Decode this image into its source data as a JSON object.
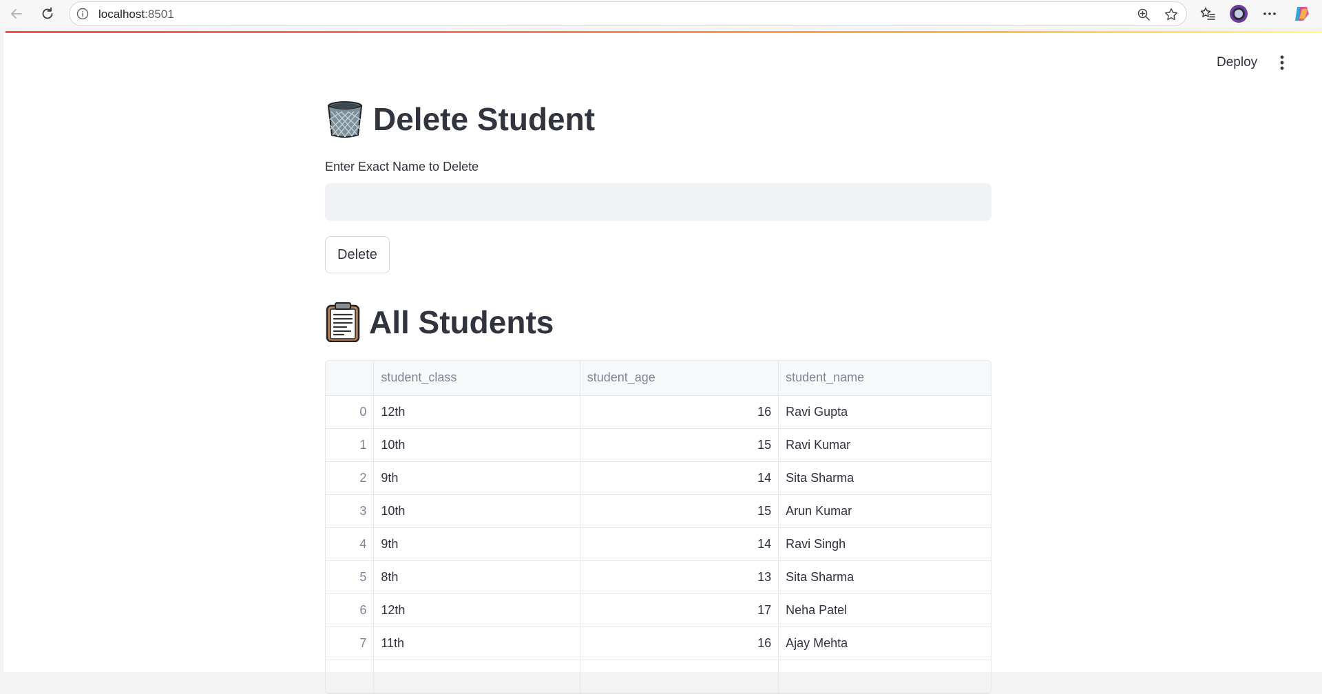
{
  "browser": {
    "url_host": "localhost",
    "url_port": ":8501",
    "icons": [
      "back-arrow-icon",
      "reload-icon",
      "site-info-icon",
      "zoom-icon",
      "star-icon",
      "favorites-icon",
      "profile-icon",
      "more-icon",
      "copilot-icon"
    ]
  },
  "header": {
    "deploy_label": "Deploy",
    "menu_icon": "kebab-menu-icon"
  },
  "delete_section": {
    "title": "Delete Student",
    "title_icon": "wastebasket-icon",
    "input_label": "Enter Exact Name to Delete",
    "input_value": "",
    "button_label": "Delete"
  },
  "students_section": {
    "title": "All Students",
    "title_icon": "clipboard-icon",
    "columns": [
      "student_class",
      "student_age",
      "student_name"
    ],
    "rows": [
      {
        "index": "0",
        "student_class": "12th",
        "student_age": "16",
        "student_name": "Ravi Gupta"
      },
      {
        "index": "1",
        "student_class": "10th",
        "student_age": "15",
        "student_name": "Ravi Kumar"
      },
      {
        "index": "2",
        "student_class": "9th",
        "student_age": "14",
        "student_name": "Sita Sharma"
      },
      {
        "index": "3",
        "student_class": "10th",
        "student_age": "15",
        "student_name": "Arun Kumar"
      },
      {
        "index": "4",
        "student_class": "9th",
        "student_age": "14",
        "student_name": "Ravi Singh"
      },
      {
        "index": "5",
        "student_class": "8th",
        "student_age": "13",
        "student_name": "Sita Sharma"
      },
      {
        "index": "6",
        "student_class": "12th",
        "student_age": "17",
        "student_name": "Neha Patel"
      },
      {
        "index": "7",
        "student_class": "11th",
        "student_age": "16",
        "student_name": "Ajay Mehta"
      }
    ]
  },
  "colors": {
    "accent": "#ff4b4b",
    "text": "#31333f",
    "input_bg": "#f0f2f6",
    "muted": "#808495"
  }
}
